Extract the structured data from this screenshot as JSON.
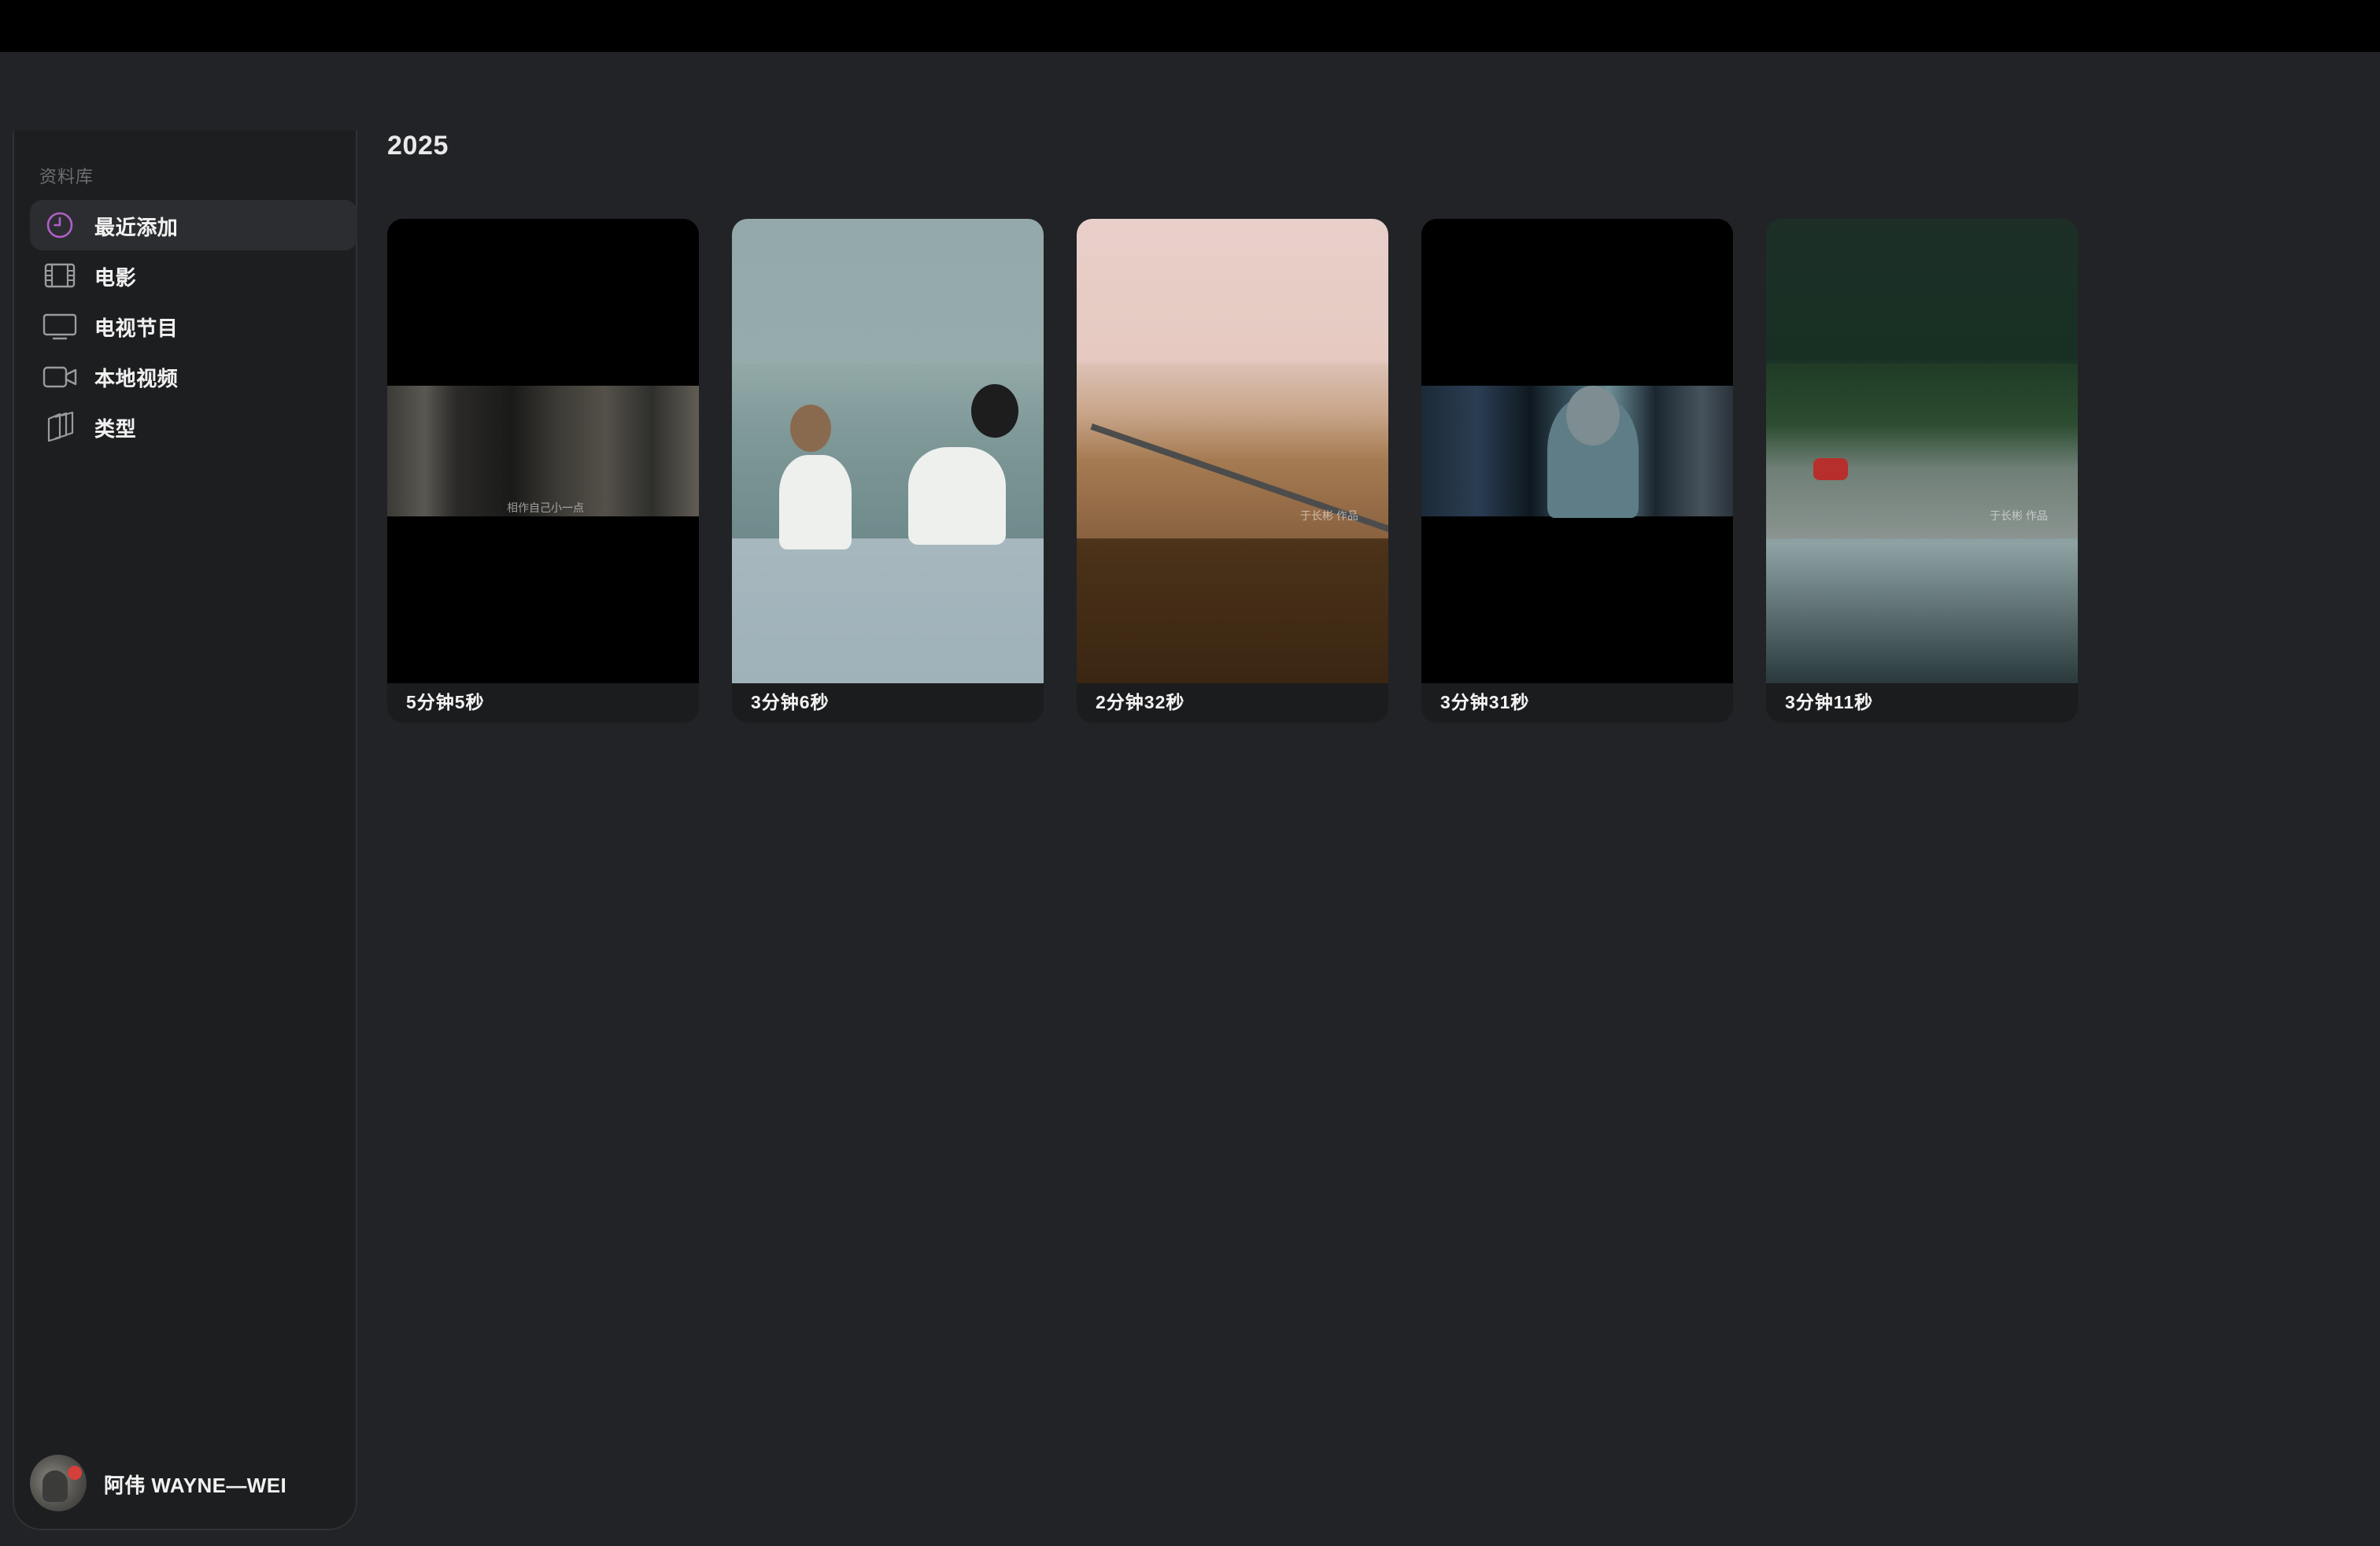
{
  "sidebar": {
    "section_title": "资料库",
    "items": [
      {
        "label": "最近添加",
        "icon": "clock-icon",
        "active": true
      },
      {
        "label": "电影",
        "icon": "film-icon",
        "active": false
      },
      {
        "label": "电视节目",
        "icon": "tv-icon",
        "active": false
      },
      {
        "label": "本地视频",
        "icon": "video-camera-icon",
        "active": false
      },
      {
        "label": "类型",
        "icon": "genre-stack-icon",
        "active": false
      }
    ],
    "profile": {
      "name": "阿伟 WAYNE—WEI"
    }
  },
  "main": {
    "heading": "2025",
    "videos": [
      {
        "duration": "5分钟5秒",
        "watermark": "相作自己小一点"
      },
      {
        "duration": "3分钟6秒"
      },
      {
        "duration": "2分钟32秒",
        "watermark": "于长彬 作品"
      },
      {
        "duration": "3分钟31秒"
      },
      {
        "duration": "3分钟11秒",
        "watermark": "于长彬 作品"
      }
    ]
  },
  "colors": {
    "background": "#222326",
    "sidebar": "#1d1e20",
    "active_item": "#2c2d30",
    "accent_icon": "#b05fc9",
    "menu_bar": "#000000"
  }
}
